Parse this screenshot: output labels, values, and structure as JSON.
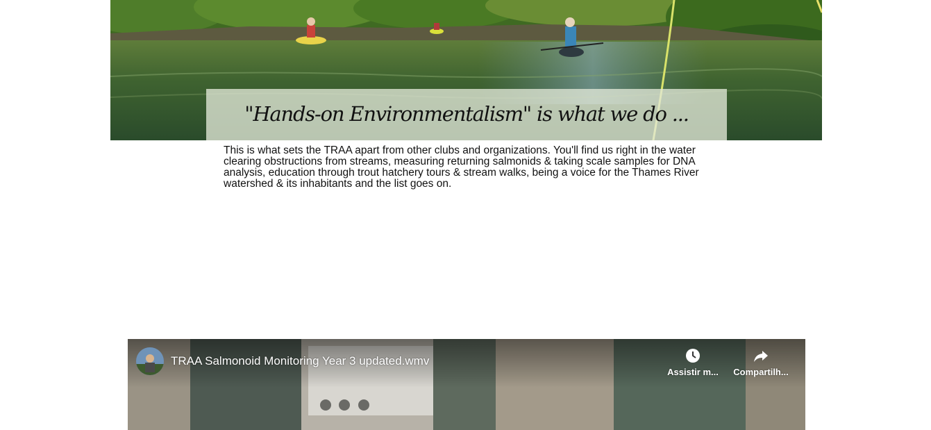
{
  "hero": {
    "caption": "\"Hands-on Environmentalism\" is what we do ..."
  },
  "intro": {
    "text": "This is what sets the TRAA apart from other clubs and organizations. You'll find us right in the water clearing obstructions from streams, measuring returning salmonids & taking scale samples for DNA analysis, education through trout hatchery tours & stream walks, being a voice for the Thames River watershed & its inhabitants and the list goes on."
  },
  "video": {
    "title": "TRAA Salmonoid Monitoring Year 3 updated.wmv",
    "watch_later_label": "Assistir m...",
    "share_label": "Compartilh...",
    "watch_later_icon": "clock-icon",
    "share_icon": "share-arrow-icon"
  }
}
